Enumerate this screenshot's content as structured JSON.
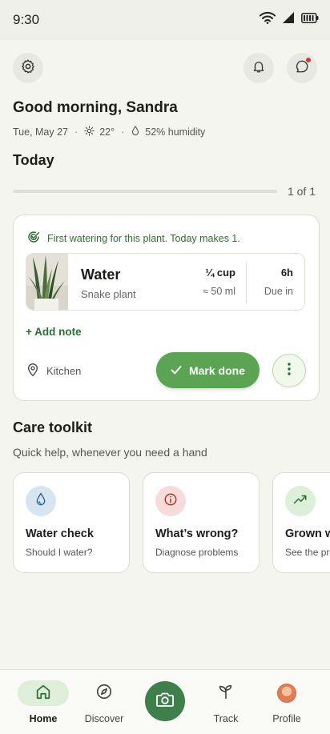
{
  "status": {
    "time": "9:30"
  },
  "header": {
    "settings_icon": "gear-icon",
    "notifications_icon": "bell-icon",
    "chat_icon": "chat-bubble-icon",
    "greeting": "Good morning, Sandra",
    "date": "Tue, May 27",
    "temperature": "22°",
    "humidity": "52% humidity"
  },
  "today": {
    "heading": "Today",
    "progress_label": "1 of 1",
    "progress_fraction": 0
  },
  "task": {
    "first_note": "First watering for this plant. Today makes 1.",
    "action": "Water",
    "plant": "Snake plant",
    "amount": "¼ cup",
    "amount_ml": "≈ 50 ml",
    "due_value": "6h",
    "due_label": "Due in",
    "add_note": "+ Add note",
    "location": "Kitchen",
    "mark_done": "Mark done"
  },
  "toolkit": {
    "heading": "Care toolkit",
    "subheading": "Quick help, whenever you need a hand",
    "cards": [
      {
        "title": "Water check",
        "subtitle": "Should I water?",
        "icon": "water-drop-icon",
        "color": "#d5e6f2"
      },
      {
        "title": "What’s wrong?",
        "subtitle": "Diagnose problems",
        "icon": "info-icon",
        "color": "#f6dcda"
      },
      {
        "title": "Grown w",
        "subtitle": "See the pr",
        "icon": "trend-up-icon",
        "color": "#dcefd8"
      }
    ]
  },
  "nav": {
    "items": [
      {
        "label": "Home",
        "icon": "home-icon",
        "active": true
      },
      {
        "label": "Discover",
        "icon": "compass-icon",
        "active": false
      },
      {
        "label": "",
        "icon": "camera-icon",
        "active": false
      },
      {
        "label": "Track",
        "icon": "sprout-icon",
        "active": false
      },
      {
        "label": "Profile",
        "icon": "avatar-icon",
        "active": false
      }
    ]
  },
  "colors": {
    "accent_green": "#5aa454",
    "dark_green": "#2f6e32",
    "fab_green": "#3f7f4c",
    "notification_dot": "#c7402f",
    "background": "#f5f5ef"
  }
}
